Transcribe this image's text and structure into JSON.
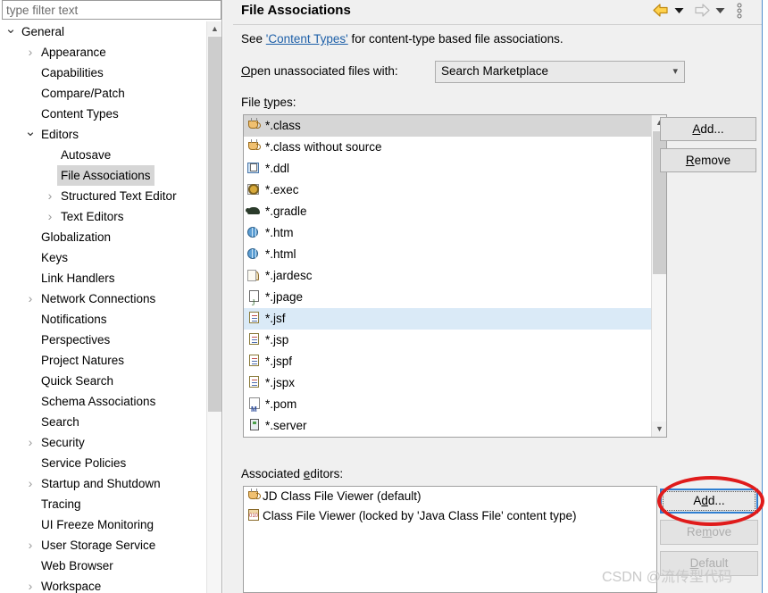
{
  "filter": {
    "placeholder": "type filter text",
    "value": ""
  },
  "tree": {
    "items": [
      {
        "label": "General",
        "indent": 0,
        "twisty": "down",
        "selected": false
      },
      {
        "label": "Appearance",
        "indent": 1,
        "twisty": "right",
        "selected": false
      },
      {
        "label": "Capabilities",
        "indent": 1,
        "twisty": "none",
        "selected": false
      },
      {
        "label": "Compare/Patch",
        "indent": 1,
        "twisty": "none",
        "selected": false
      },
      {
        "label": "Content Types",
        "indent": 1,
        "twisty": "none",
        "selected": false
      },
      {
        "label": "Editors",
        "indent": 1,
        "twisty": "down",
        "selected": false
      },
      {
        "label": "Autosave",
        "indent": 2,
        "twisty": "none",
        "selected": false
      },
      {
        "label": "File Associations",
        "indent": 2,
        "twisty": "none",
        "selected": true
      },
      {
        "label": "Structured Text Editor",
        "indent": 2,
        "twisty": "right",
        "selected": false
      },
      {
        "label": "Text Editors",
        "indent": 2,
        "twisty": "right",
        "selected": false
      },
      {
        "label": "Globalization",
        "indent": 1,
        "twisty": "none",
        "selected": false
      },
      {
        "label": "Keys",
        "indent": 1,
        "twisty": "none",
        "selected": false
      },
      {
        "label": "Link Handlers",
        "indent": 1,
        "twisty": "none",
        "selected": false
      },
      {
        "label": "Network Connections",
        "indent": 1,
        "twisty": "right",
        "selected": false
      },
      {
        "label": "Notifications",
        "indent": 1,
        "twisty": "none",
        "selected": false
      },
      {
        "label": "Perspectives",
        "indent": 1,
        "twisty": "none",
        "selected": false
      },
      {
        "label": "Project Natures",
        "indent": 1,
        "twisty": "none",
        "selected": false
      },
      {
        "label": "Quick Search",
        "indent": 1,
        "twisty": "none",
        "selected": false
      },
      {
        "label": "Schema Associations",
        "indent": 1,
        "twisty": "none",
        "selected": false
      },
      {
        "label": "Search",
        "indent": 1,
        "twisty": "none",
        "selected": false
      },
      {
        "label": "Security",
        "indent": 1,
        "twisty": "right",
        "selected": false
      },
      {
        "label": "Service Policies",
        "indent": 1,
        "twisty": "none",
        "selected": false
      },
      {
        "label": "Startup and Shutdown",
        "indent": 1,
        "twisty": "right",
        "selected": false
      },
      {
        "label": "Tracing",
        "indent": 1,
        "twisty": "none",
        "selected": false
      },
      {
        "label": "UI Freeze Monitoring",
        "indent": 1,
        "twisty": "none",
        "selected": false
      },
      {
        "label": "User Storage Service",
        "indent": 1,
        "twisty": "right",
        "selected": false
      },
      {
        "label": "Web Browser",
        "indent": 1,
        "twisty": "none",
        "selected": false
      },
      {
        "label": "Workspace",
        "indent": 1,
        "twisty": "right",
        "selected": false
      }
    ]
  },
  "header": {
    "title": "File Associations",
    "back_icon": "back-arrow-icon",
    "back_dropdown_icon": "chevron-down-icon",
    "forward_icon": "forward-arrow-icon",
    "forward_dropdown_icon": "chevron-down-icon",
    "menu_icon": "vertical-dots-icon"
  },
  "description": {
    "prefix": "See ",
    "link": "'Content Types'",
    "suffix": " for content-type based file associations."
  },
  "open_with": {
    "label_mnemonic": "O",
    "label_rest": "pen unassociated files with:",
    "selected": "Search Marketplace",
    "chevron": "chevron-down-icon"
  },
  "file_types": {
    "label_prefix": "File ",
    "label_mnemonic": "t",
    "label_rest": "ypes:",
    "rows": [
      {
        "text": "*.class",
        "icon": "java-cup-icon",
        "state": "selected-gray"
      },
      {
        "text": "*.class without source",
        "icon": "java-cup-icon",
        "state": "normal"
      },
      {
        "text": "*.ddl",
        "icon": "ddl-book-icon",
        "state": "normal"
      },
      {
        "text": "*.exec",
        "icon": "gears-icon",
        "state": "normal"
      },
      {
        "text": "*.gradle",
        "icon": "elephant-icon",
        "state": "normal"
      },
      {
        "text": "*.htm",
        "icon": "globe-icon",
        "state": "normal"
      },
      {
        "text": "*.html",
        "icon": "globe-icon",
        "state": "normal"
      },
      {
        "text": "*.jardesc",
        "icon": "jar-icon",
        "state": "normal"
      },
      {
        "text": "*.jpage",
        "icon": "jpage-icon",
        "state": "normal"
      },
      {
        "text": "*.jsf",
        "icon": "jsp-doc-icon",
        "state": "selected-blue"
      },
      {
        "text": "*.jsp",
        "icon": "jsp-doc-icon",
        "state": "normal"
      },
      {
        "text": "*.jspf",
        "icon": "jsp-doc-icon",
        "state": "normal"
      },
      {
        "text": "*.jspx",
        "icon": "jsp-doc-icon",
        "state": "normal"
      },
      {
        "text": "*.pom",
        "icon": "maven-pom-icon",
        "state": "normal"
      },
      {
        "text": "*.server",
        "icon": "server-icon",
        "state": "normal"
      }
    ],
    "scrollbar": {
      "up_icon": "scroll-up-icon",
      "down_icon": "scroll-down-icon"
    }
  },
  "file_type_buttons": {
    "add_mnemonic": "A",
    "add_rest": "dd...",
    "remove_mnemonic": "R",
    "remove_rest": "emove"
  },
  "associated_editors": {
    "label_prefix": "Associated ",
    "label_mnemonic": "e",
    "label_rest": "ditors:",
    "rows": [
      {
        "text": "JD Class File Viewer (default)",
        "icon": "java-cup-icon"
      },
      {
        "text": "Class File Viewer (locked by 'Java Class File' content type)",
        "icon": "class-binary-icon"
      }
    ]
  },
  "editor_buttons": {
    "add_prefix": "A",
    "add_mnemonic": "d",
    "add_rest": "d...",
    "add_state": "focused",
    "remove_prefix": "Re",
    "remove_mnemonic": "m",
    "remove_rest": "ove",
    "remove_state": "disabled",
    "default_prefix": "",
    "default_mnemonic": "D",
    "default_rest": "efault",
    "default_state": "disabled"
  },
  "annotation": {
    "shape": "red-ellipse",
    "color": "#e01b1b",
    "target": "add-editor-button"
  },
  "watermark": {
    "text": "CSDN @流传型代码",
    "color": "#c9c9c9"
  },
  "colors": {
    "selection_gray": "#d6d6d6",
    "selection_blue": "#daeaf7",
    "link_blue": "#1d5fa8",
    "focus_blue": "#2f7fd1",
    "panel_bg": "#f0f0f0",
    "annotation_red": "#e01b1b"
  }
}
